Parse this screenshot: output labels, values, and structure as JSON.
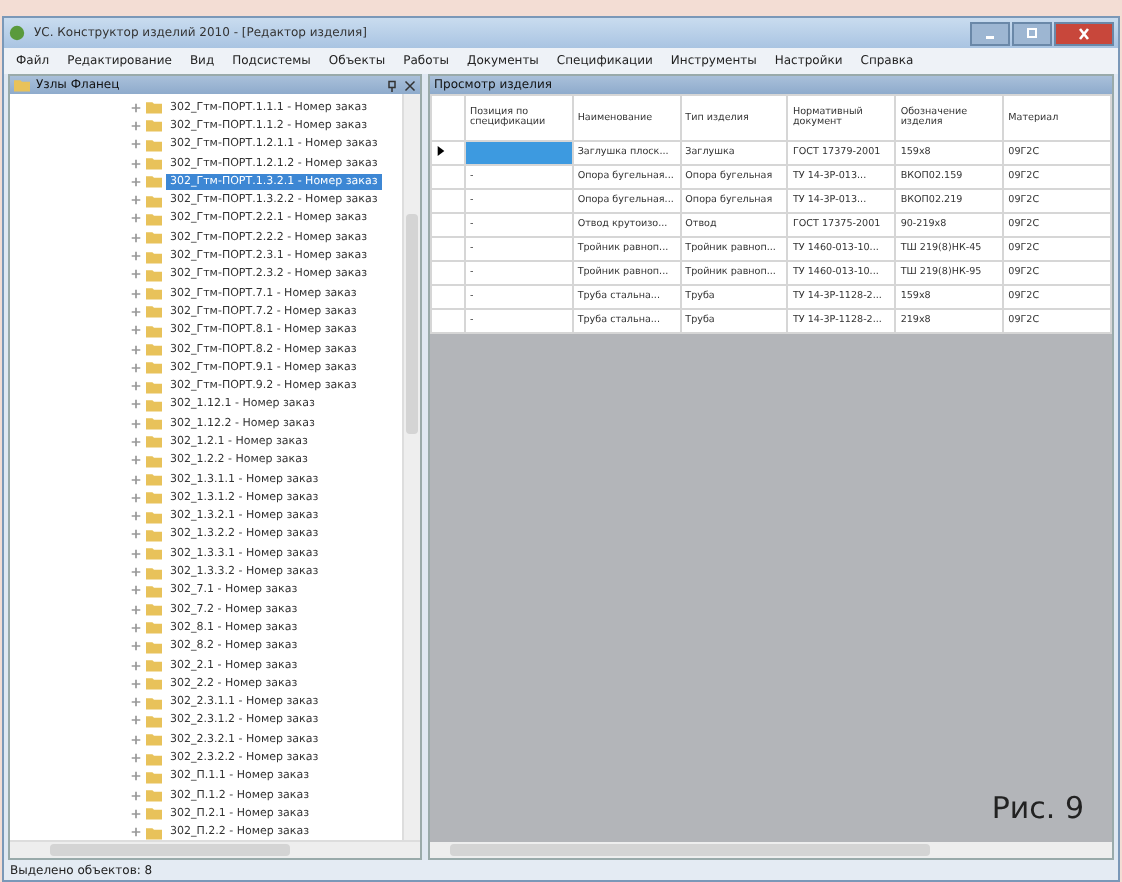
{
  "window": {
    "title": "УС. Конструктор изделий 2010 - [Редактор изделия]"
  },
  "menu": [
    "Файл",
    "Редактирование",
    "Вид",
    "Подсистемы",
    "Объекты",
    "Работы",
    "Документы",
    "Спецификации",
    "Инструменты",
    "Настройки",
    "Справка"
  ],
  "tree_panel": {
    "title": "Узлы Фланец",
    "items": [
      {
        "label": "302_Гтм-ПОРТ.1.1.1 - Номер заказ",
        "selected": false
      },
      {
        "label": "302_Гтм-ПОРТ.1.1.2 - Номер заказ",
        "selected": false
      },
      {
        "label": "302_Гтм-ПОРТ.1.2.1.1 - Номер заказ",
        "selected": false
      },
      {
        "label": "302_Гтм-ПОРТ.1.2.1.2 - Номер заказ",
        "selected": false
      },
      {
        "label": "302_Гтм-ПОРТ.1.3.2.1 - Номер заказ",
        "selected": true
      },
      {
        "label": "302_Гтм-ПОРТ.1.3.2.2 - Номер заказ",
        "selected": false
      },
      {
        "label": "302_Гтм-ПОРТ.2.2.1 - Номер заказ",
        "selected": false
      },
      {
        "label": "302_Гтм-ПОРТ.2.2.2 - Номер заказ",
        "selected": false
      },
      {
        "label": "302_Гтм-ПОРТ.2.3.1 - Номер заказ",
        "selected": false
      },
      {
        "label": "302_Гтм-ПОРТ.2.3.2 - Номер заказ",
        "selected": false
      },
      {
        "label": "302_Гтм-ПОРТ.7.1 - Номер заказ",
        "selected": false
      },
      {
        "label": "302_Гтм-ПОРТ.7.2 - Номер заказ",
        "selected": false
      },
      {
        "label": "302_Гтм-ПОРТ.8.1 - Номер заказ",
        "selected": false
      },
      {
        "label": "302_Гтм-ПОРТ.8.2 - Номер заказ",
        "selected": false
      },
      {
        "label": "302_Гтм-ПОРТ.9.1 - Номер заказ",
        "selected": false
      },
      {
        "label": "302_Гтм-ПОРТ.9.2 - Номер заказ",
        "selected": false
      },
      {
        "label": "302_1.12.1 - Номер заказ",
        "selected": false
      },
      {
        "label": "302_1.12.2 - Номер заказ",
        "selected": false
      },
      {
        "label": "302_1.2.1 - Номер заказ",
        "selected": false
      },
      {
        "label": "302_1.2.2 - Номер заказ",
        "selected": false
      },
      {
        "label": "302_1.3.1.1 - Номер заказ",
        "selected": false
      },
      {
        "label": "302_1.3.1.2 - Номер заказ",
        "selected": false
      },
      {
        "label": "302_1.3.2.1 - Номер заказ",
        "selected": false
      },
      {
        "label": "302_1.3.2.2 - Номер заказ",
        "selected": false
      },
      {
        "label": "302_1.3.3.1 - Номер заказ",
        "selected": false
      },
      {
        "label": "302_1.3.3.2 - Номер заказ",
        "selected": false
      },
      {
        "label": "302_7.1 - Номер заказ",
        "selected": false
      },
      {
        "label": "302_7.2 - Номер заказ",
        "selected": false
      },
      {
        "label": "302_8.1 - Номер заказ",
        "selected": false
      },
      {
        "label": "302_8.2 - Номер заказ",
        "selected": false
      },
      {
        "label": "302_2.1 - Номер заказ",
        "selected": false
      },
      {
        "label": "302_2.2 - Номер заказ",
        "selected": false
      },
      {
        "label": "302_2.3.1.1 - Номер заказ",
        "selected": false
      },
      {
        "label": "302_2.3.1.2 - Номер заказ",
        "selected": false
      },
      {
        "label": "302_2.3.2.1 - Номер заказ",
        "selected": false
      },
      {
        "label": "302_2.3.2.2 - Номер заказ",
        "selected": false
      },
      {
        "label": "302_П.1.1 - Номер заказ",
        "selected": false
      },
      {
        "label": "302_П.1.2 - Номер заказ",
        "selected": false
      },
      {
        "label": "302_П.2.1 - Номер заказ",
        "selected": false
      },
      {
        "label": "302_П.2.2 - Номер заказ",
        "selected": false
      }
    ]
  },
  "table_panel": {
    "title": "Просмотр изделия",
    "columns": [
      "Позиция по спецификации",
      "Наименование",
      "Тип изделия",
      "Нормативный документ",
      "Обозначение изделия",
      "Материал"
    ],
    "rows": [
      {
        "current": true,
        "cells": [
          "",
          "Заглушка плоск...",
          "Заглушка",
          "ГОСТ 17379-2001",
          "159x8",
          "09Г2С"
        ]
      },
      {
        "current": false,
        "cells": [
          "-",
          "Опора бугельная...",
          "Опора бугельная",
          "ТУ 14-3Р-013...",
          "ВКОП02.159",
          "09Г2С"
        ]
      },
      {
        "current": false,
        "cells": [
          "-",
          "Опора бугельная...",
          "Опора бугельная",
          "ТУ 14-3Р-013...",
          "ВКОП02.219",
          "09Г2С"
        ]
      },
      {
        "current": false,
        "cells": [
          "-",
          "Отвод крутоизо...",
          "Отвод",
          "ГОСТ 17375-2001",
          "90-219x8",
          "09Г2С"
        ]
      },
      {
        "current": false,
        "cells": [
          "-",
          "Тройник равноп...",
          "Тройник равноп...",
          "ТУ 1460-013-10...",
          "ТШ 219(8)НК-45",
          "09Г2С"
        ]
      },
      {
        "current": false,
        "cells": [
          "-",
          "Тройник равноп...",
          "Тройник равноп...",
          "ТУ 1460-013-10...",
          "ТШ 219(8)НК-95",
          "09Г2С"
        ]
      },
      {
        "current": false,
        "cells": [
          "-",
          "Труба стальна...",
          "Труба",
          "ТУ 14-3Р-1128-2...",
          "159x8",
          "09Г2С"
        ]
      },
      {
        "current": false,
        "cells": [
          "-",
          "Труба стальна...",
          "Труба",
          "ТУ 14-3Р-1128-2...",
          "219x8",
          "09Г2С"
        ]
      }
    ]
  },
  "status_bar": {
    "text": "Выделено объектов: 8"
  },
  "caption": "Рис. 9"
}
